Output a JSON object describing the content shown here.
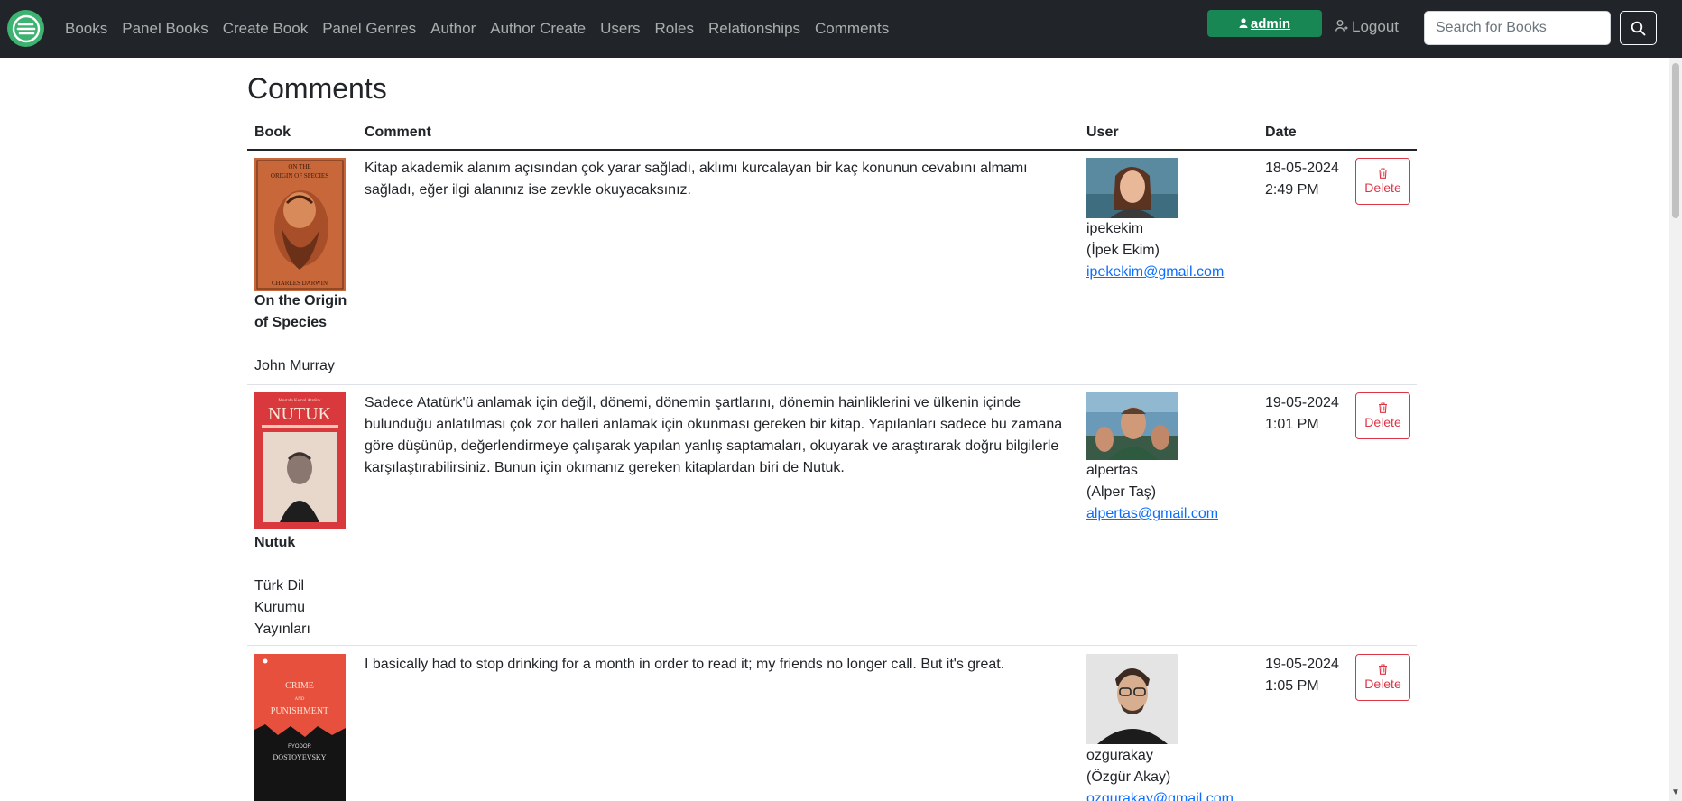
{
  "nav": {
    "links": [
      "Books",
      "Panel Books",
      "Create Book",
      "Panel Genres",
      "Author",
      "Author Create",
      "Users",
      "Roles",
      "Relationships",
      "Comments"
    ],
    "admin_label": "admin",
    "logout_label": "Logout",
    "search_placeholder": "Search for Books"
  },
  "page": {
    "title": "Comments"
  },
  "table": {
    "headers": {
      "book": "Book",
      "comment": "Comment",
      "user": "User",
      "date": "Date"
    },
    "delete_label": "Delete",
    "rows": [
      {
        "book_title": "On the Origin of Species",
        "publisher": "John Murray",
        "comment": "Kitap akademik alanım açısından çok yarar sağladı, aklımı kurcalayan bir kaç konunun cevabını almamı sağladı, eğer ilgi alanınız ise zevkle okuyacaksınız.",
        "username": "ipekekim",
        "fullname": "(İpek Ekim)",
        "email": "ipekekim@gmail.com",
        "date": "18-05-2024",
        "time": "2:49 PM",
        "cover": {
          "top_text": "ON THE",
          "title_text": "ORIGIN OF SPECIES",
          "bottom_text": "CHARLES DARWIN"
        }
      },
      {
        "book_title": "Nutuk",
        "publisher": "Türk Dil Kurumu Yayınları",
        "comment": "Sadece Atatürk'ü anlamak için değil, dönemi, dönemin şartlarını, dönemin hainliklerini ve ülkenin içinde bulunduğu anlatılması çok zor halleri anlamak için okunması gereken bir kitap. Yapılanları sadece bu zamana göre düşünüp, değerlendirmeye çalışarak yapılan yanlış saptamaları, okuyarak ve araştırarak doğru bilgilerle karşılaştırabilirsiniz. Bunun için okımanız gereken kitaplardan biri de Nutuk.",
        "username": "alpertas",
        "fullname": "(Alper Taş)",
        "email": "alpertas@gmail.com",
        "date": "19-05-2024",
        "time": "1:01 PM",
        "cover": {
          "top_text": "Mustafa Kemal Atatürk",
          "title_text": "NUTUK"
        }
      },
      {
        "book_title": "Crime and Punishment",
        "publisher": "",
        "comment": "I basically had to stop drinking for a month in order to read it; my friends no longer call. But it's great.",
        "username": "ozgurakay",
        "fullname": "(Özgür Akay)",
        "email": "ozgurakay@gmail.com",
        "date": "19-05-2024",
        "time": "1:05 PM",
        "cover": {
          "line1": "CRIME",
          "line2": "AND",
          "line3": "PUNISHMENT",
          "author": "FYODOR",
          "author2": "DOSTOYEVSKY"
        }
      }
    ]
  },
  "colors": {
    "navbar": "#212529",
    "admin_btn": "#198754",
    "delete": "#dc3545",
    "link": "#0d6efd",
    "logo": "#3cb371"
  }
}
